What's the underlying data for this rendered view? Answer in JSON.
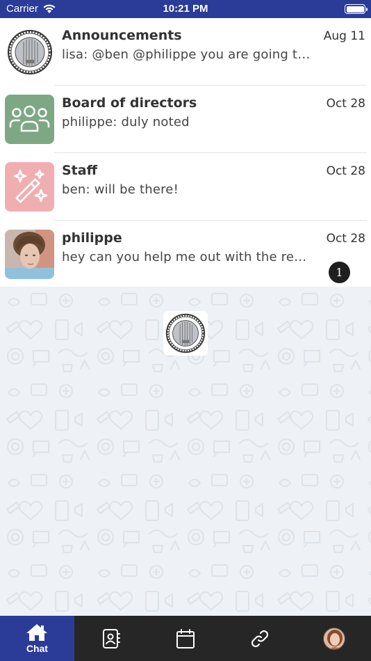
{
  "status_bar": {
    "carrier": "Carrier",
    "time": "10:21 PM",
    "battery_level": 1.0
  },
  "chats": [
    {
      "title": "Announcements",
      "preview": "lisa: @ben @philippe you are going to like this",
      "date": "Aug 11",
      "avatar": "seal-avatar"
    },
    {
      "title": "Board of directors",
      "preview": "philippe: duly noted",
      "date": "Oct 28",
      "avatar": "group-icon",
      "avatar_color": "#7da883"
    },
    {
      "title": "Staff",
      "preview": "ben: will be there!",
      "date": "Oct 28",
      "avatar": "magic-wand-icon",
      "avatar_color": "#f0aeb0"
    },
    {
      "title": "philippe",
      "preview": "hey can you help me out with the report please",
      "date": "Oct 28",
      "avatar": "user-photo",
      "unread": "1"
    }
  ],
  "tab_bar": {
    "tabs": [
      {
        "label": "Chat",
        "icon": "home-icon",
        "active": true
      },
      {
        "label": "",
        "icon": "contacts-icon"
      },
      {
        "label": "",
        "icon": "calendar-icon"
      },
      {
        "label": "",
        "icon": "link-icon"
      },
      {
        "label": "",
        "icon": "profile-avatar"
      }
    ]
  },
  "colors": {
    "header": "#2b3b98",
    "tab_bar": "#262626",
    "active_tab": "#2b3b98",
    "wallpaper": "#eef1f5"
  }
}
